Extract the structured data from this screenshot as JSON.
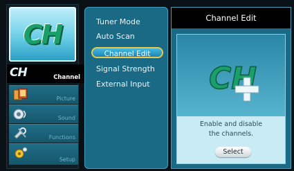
{
  "logo": {
    "text": "CH"
  },
  "sidebar": {
    "items": [
      {
        "label": "Channel",
        "icon": "ch-icon",
        "active": true
      },
      {
        "label": "Picture",
        "icon": "picture-icon",
        "active": false
      },
      {
        "label": "Sound",
        "icon": "sound-icon",
        "active": false
      },
      {
        "label": "Functions",
        "icon": "functions-icon",
        "active": false
      },
      {
        "label": "Setup",
        "icon": "setup-icon",
        "active": false
      }
    ]
  },
  "options": {
    "items": [
      {
        "label": "Tuner Mode"
      },
      {
        "label": "Auto Scan"
      },
      {
        "label": "Channel Edit",
        "selected": true
      },
      {
        "label": "Signal Strength"
      },
      {
        "label": "External Input"
      }
    ]
  },
  "detail": {
    "title": "Channel Edit",
    "description_line1": "Enable and disable",
    "description_line2": "the channels.",
    "select_label": "Select"
  },
  "colors": {
    "accent": "#1b6a85",
    "highlight_border": "#e9c94a",
    "icon_green": "#1a9e6a"
  }
}
